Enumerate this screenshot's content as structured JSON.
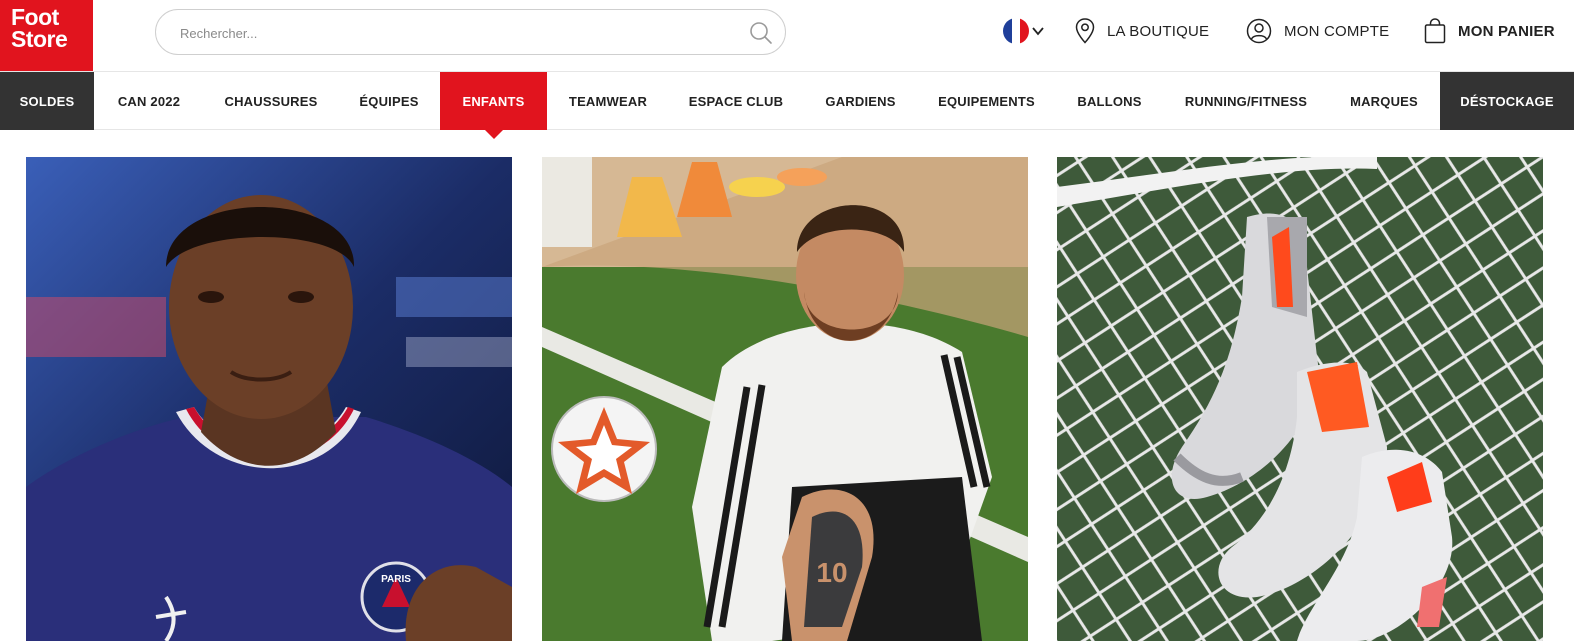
{
  "brand": {
    "line1": "Foot",
    "line2": "Store",
    "color": "#e1141e"
  },
  "search": {
    "placeholder": "Rechercher..."
  },
  "header_links": {
    "store": "LA BOUTIQUE",
    "account": "MON COMPTE",
    "cart": "MON PANIER"
  },
  "language": {
    "flag": "france-flag-icon"
  },
  "nav": {
    "items": [
      "SOLDES",
      "CAN 2022",
      "CHAUSSURES",
      "ÉQUIPES",
      "ENFANTS",
      "TEAMWEAR",
      "ESPACE CLUB",
      "GARDIENS",
      "EQUIPEMENTS",
      "BALLONS",
      "RUNNING/FITNESS",
      "MARQUES",
      "DÉSTOCKAGE"
    ],
    "active": "ENFANTS"
  },
  "tiles": [
    {
      "name": "player-portrait-psg-jersey",
      "jersey_text": "PARIS"
    },
    {
      "name": "player-sitting-on-pitch-with-ball",
      "tattoo_text": "10"
    },
    {
      "name": "football-boots-in-goal-net"
    }
  ],
  "colors": {
    "accent_red": "#e1141e",
    "dark_nav": "#333333"
  }
}
